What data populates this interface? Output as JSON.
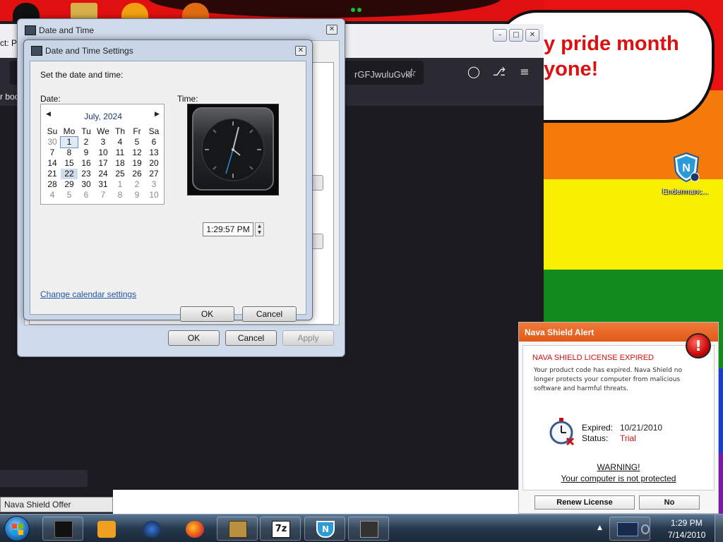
{
  "desktop": {
    "speech_line1": "y pride month",
    "speech_line2": "yone!",
    "icon_label": "Endermanc..."
  },
  "browser": {
    "tab_text": "ct: Po",
    "url_text": "rGFJwuluGvkl",
    "bookmark_text": "r boo"
  },
  "date_time_window": {
    "title": "Date and Time",
    "ok_label": "OK",
    "cancel_label": "Cancel",
    "apply_label": "Apply"
  },
  "settings_dialog": {
    "title": "Date and Time Settings",
    "instruction": "Set the date and time:",
    "date_label": "Date:",
    "time_label": "Time:",
    "month_year": "July, 2024",
    "weekdays": [
      "Su",
      "Mo",
      "Tu",
      "We",
      "Th",
      "Fr",
      "Sa"
    ],
    "weeks": [
      [
        "30",
        "1",
        "2",
        "3",
        "4",
        "5",
        "6"
      ],
      [
        "7",
        "8",
        "9",
        "10",
        "11",
        "12",
        "13"
      ],
      [
        "14",
        "15",
        "16",
        "17",
        "18",
        "19",
        "20"
      ],
      [
        "21",
        "22",
        "23",
        "24",
        "25",
        "26",
        "27"
      ],
      [
        "28",
        "29",
        "30",
        "31",
        "1",
        "2",
        "3"
      ],
      [
        "4",
        "5",
        "6",
        "7",
        "8",
        "9",
        "10"
      ]
    ],
    "selected_day": "1",
    "time_value": "1:29:57 PM",
    "calendar_link": "Change calendar settings",
    "ok_label": "OK",
    "cancel_label": "Cancel"
  },
  "nava_alert": {
    "header": "Nava Shield Alert",
    "headline": "NAVA SHIELD LICENSE EXPIRED",
    "description": "Your product code has expired. Nava Shield no longer protects your computer from malicious software and harmful threats.",
    "expired_label": "Expired:",
    "expired_value": "10/21/2010",
    "status_label": "Status:",
    "status_value": "Trial",
    "warning": "WARNING!",
    "not_protected": "Your computer is not protected",
    "renew_label": "Renew License",
    "no_label": "No"
  },
  "offer_label": "Nava Shield Offer",
  "taskbar": {
    "time": "1:29 PM",
    "date": "7/14/2010"
  },
  "colors": {
    "nava_orange": "#e8632a",
    "alert_red": "#d01010",
    "link_blue": "#1f56a8",
    "browser_dark": "#1c1b22"
  }
}
